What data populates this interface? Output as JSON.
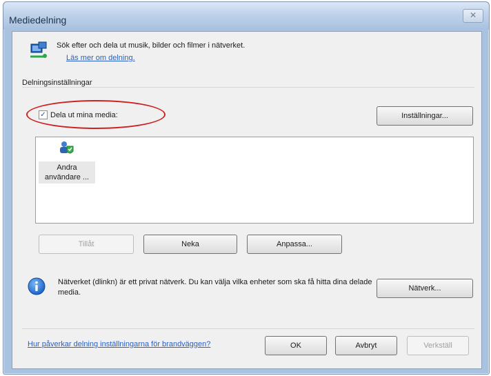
{
  "window": {
    "title": "Mediedelning",
    "close_glyph": "✕"
  },
  "header": {
    "description": "Sök efter och dela ut musik, bilder och filmer i nätverket.",
    "learn_more_link": "Läs mer om delning."
  },
  "section": {
    "label": "Delningsinställningar"
  },
  "share_checkbox": {
    "label": "Dela ut mina media:",
    "checked": true,
    "check_glyph": "✓"
  },
  "settings_button": "Inställningar...",
  "device_list": {
    "items": [
      {
        "label_line1": "Andra",
        "label_line2": "användare ..."
      }
    ]
  },
  "actions": {
    "allow": "Tillåt",
    "deny": "Neka",
    "customize": "Anpassa..."
  },
  "network_info": {
    "text": "Nätverket (dlinkn) är ett privat nätverk. Du kan välja vilka enheter som ska få hitta dina delade media.",
    "button": "Nätverk..."
  },
  "footer": {
    "firewall_link": "Hur påverkar delning inställningarna för brandväggen?",
    "ok": "OK",
    "cancel": "Avbryt",
    "apply": "Verkställ"
  },
  "colors": {
    "link": "#2a5fc1",
    "annotation_oval": "#cc2222",
    "info_icon": "#1c63c8"
  }
}
